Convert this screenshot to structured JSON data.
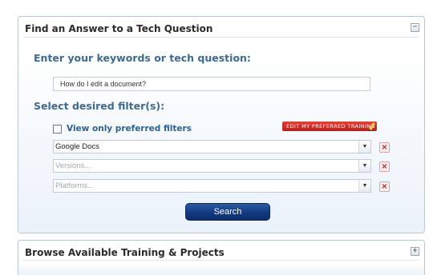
{
  "find_panel": {
    "title": "Find an Answer to a Tech Question",
    "toggle": "−",
    "keywords_heading": "Enter your keywords or tech question:",
    "keywords_value": "How do I edit a document?",
    "filters_heading": "Select desired filter(s):",
    "preferred_label": "View only preferred filters",
    "edit_badge": "EDIT MY PREFERRED TRAINING",
    "filters": [
      {
        "value": "Google Docs",
        "placeholder": false
      },
      {
        "value": "Versions...",
        "placeholder": true
      },
      {
        "value": "Platforms...",
        "placeholder": true
      }
    ],
    "remove_glyph": "×",
    "dropdown_glyph": "▼",
    "search_label": "Search"
  },
  "browse_panel": {
    "title": "Browse Available Training & Projects",
    "toggle": "+"
  },
  "colors": {
    "heading": "#3f6a8f",
    "search_button": "#123a80",
    "badge": "#c9302c"
  }
}
